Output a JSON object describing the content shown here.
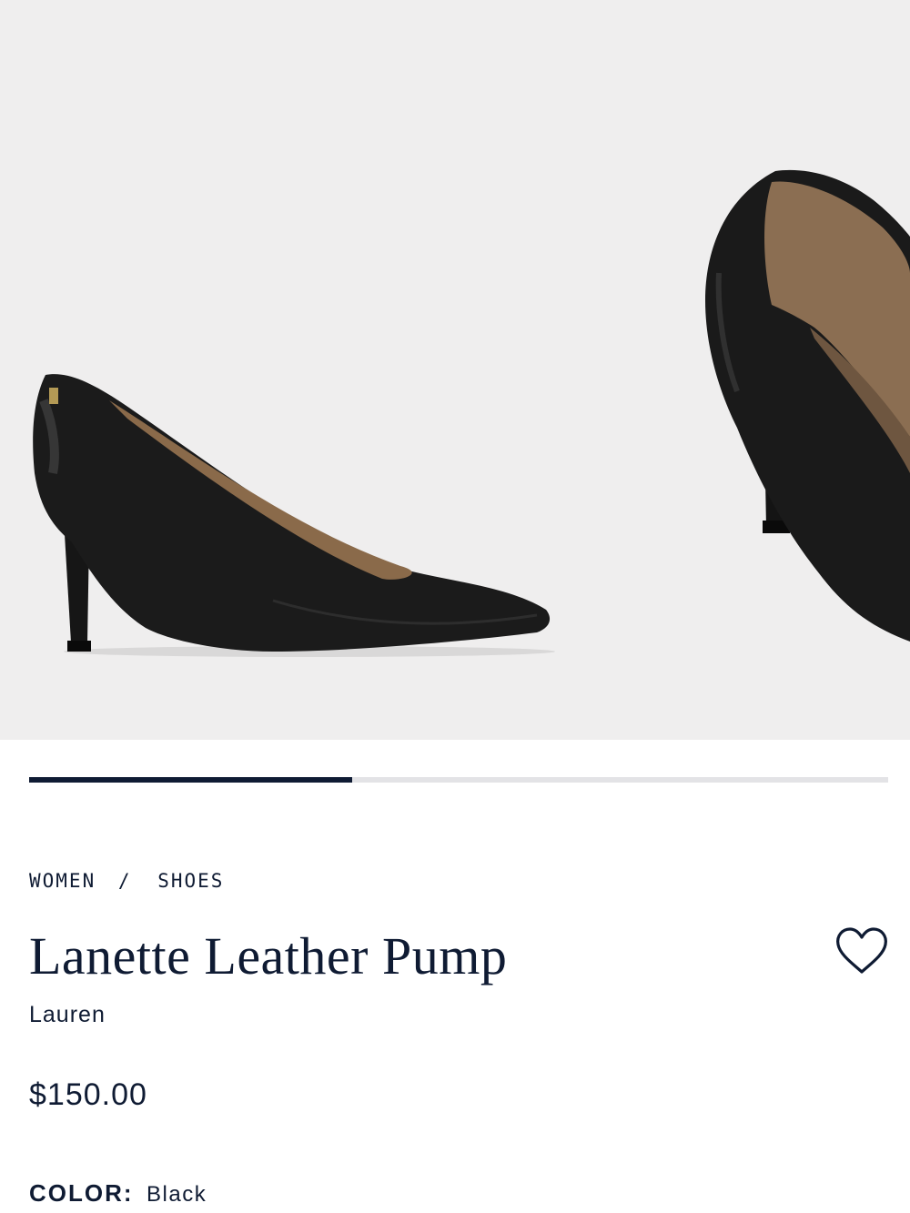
{
  "gallery": {
    "image_count_position_fraction": 0.376,
    "images": [
      {
        "alt_icon": "black-pointed-pump-side-view"
      },
      {
        "alt_icon": "black-pointed-pump-rear-view"
      }
    ]
  },
  "breadcrumb": {
    "items": [
      "WOMEN",
      "SHOES"
    ],
    "separator": "/"
  },
  "product": {
    "title": "Lanette Leather Pump",
    "brand": "Lauren",
    "price": "$150.00",
    "color_label": "COLOR:",
    "color_value": "Black"
  },
  "colors": {
    "accent": "#0f1b33",
    "gallery_bg": "#efeeee",
    "progress_track": "#e3e3e6"
  }
}
